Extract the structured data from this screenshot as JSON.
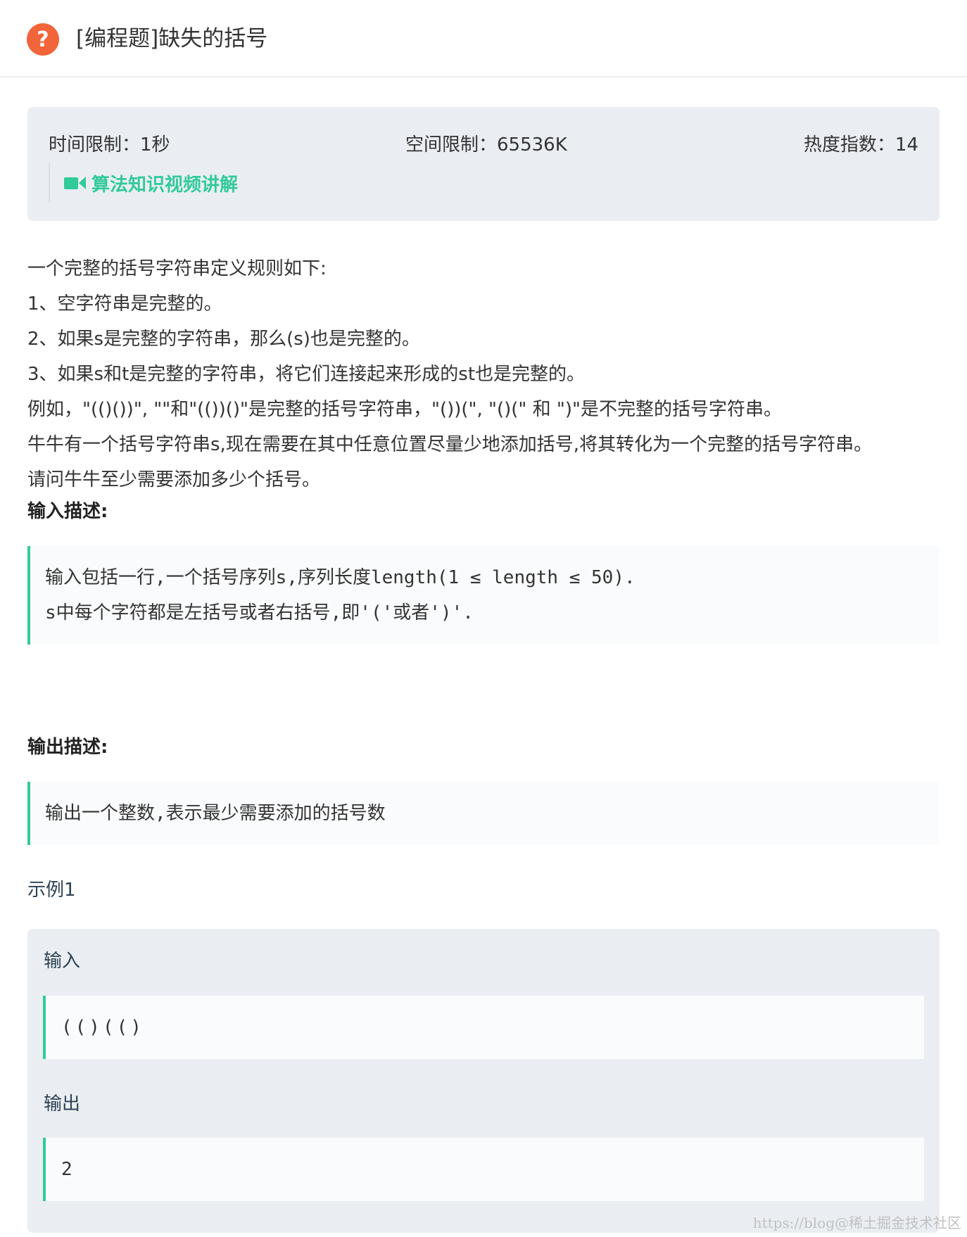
{
  "header": {
    "icon": "question-circle-icon",
    "title": "[编程题]缺失的括号"
  },
  "info": {
    "time_limit": "时间限制：1秒",
    "memory_limit": "空间限制：65536K",
    "heat": "热度指数：14",
    "video_icon": "video-camera-icon",
    "video_link": "算法知识视频讲解"
  },
  "description": {
    "lines": [
      "一个完整的括号字符串定义规则如下:",
      "1、空字符串是完整的。",
      "2、如果s是完整的字符串，那么(s)也是完整的。",
      "3、如果s和t是完整的字符串，将它们连接起来形成的st也是完整的。",
      "例如，\"(()())\", \"\"和\"(())()\"是完整的括号字符串，\"())(\", \"()(\" 和 \")\"是不完整的括号字符串。",
      "牛牛有一个括号字符串s,现在需要在其中任意位置尽量少地添加括号,将其转化为一个完整的括号字符串。",
      "请问牛牛至少需要添加多少个括号。"
    ]
  },
  "input_section": {
    "title": "输入描述:",
    "lines": [
      "输入包括一行,一个括号序列s,序列长度length(1 ≤ length ≤ 50).",
      "s中每个字符都是左括号或者右括号,即'('或者')'."
    ]
  },
  "output_section": {
    "title": "输出描述:",
    "lines": [
      "输出一个整数,表示最少需要添加的括号数"
    ]
  },
  "example": {
    "title": "示例1",
    "input_label": "输入",
    "input_value": "(()(()",
    "output_label": "输出",
    "output_value": "2"
  },
  "watermark": "https://blog@稀土掘金技术社区",
  "colors": {
    "accent": "#32ca99",
    "icon": "#f2643a",
    "panel": "#eaeef2"
  }
}
